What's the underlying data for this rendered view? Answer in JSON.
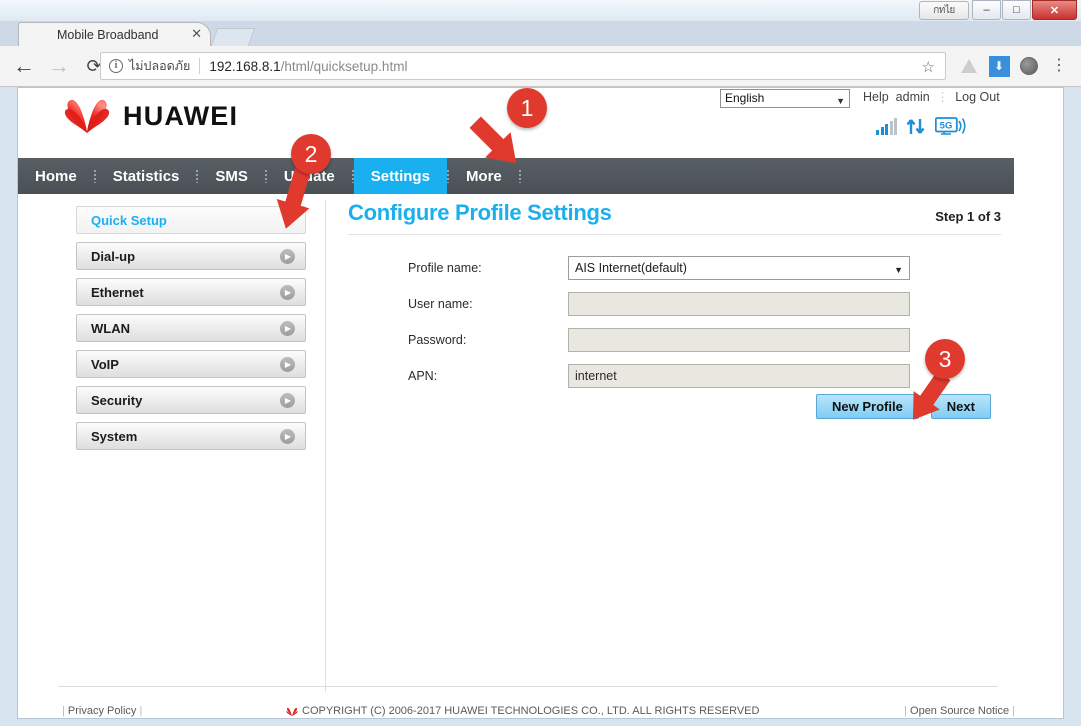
{
  "window": {
    "ime_label": "กทไย",
    "controls": [
      {
        "name": "minimize",
        "glyph": "–"
      },
      {
        "name": "maximize",
        "glyph": "□"
      },
      {
        "name": "close",
        "glyph": "✕"
      }
    ]
  },
  "browser": {
    "tab_title": "Mobile Broadband",
    "tab_close_glyph": "✕",
    "back_glyph": "←",
    "forward_glyph": "→",
    "reload_glyph": "⟳",
    "security_glyph": "i",
    "security_text": "ไม่ปลอดภัย",
    "url_host": "192.168.8.1",
    "url_path": "/html/quicksetup.html",
    "star_glyph": "☆",
    "menu_glyph": "⋮",
    "extensions": [
      "drive-icon",
      "download-icon",
      "film-icon"
    ]
  },
  "header": {
    "brand": "HUAWEI",
    "language": "English",
    "lang_arrow": "▼",
    "help_label": "Help",
    "user_label": "admin",
    "logout_label": "Log Out",
    "status_icons": [
      "signal-bars-icon",
      "data-transfer-icon",
      "5g-network-icon"
    ],
    "network_label": "5G"
  },
  "nav": {
    "items": [
      {
        "label": "Home",
        "active": false
      },
      {
        "label": "Statistics",
        "active": false
      },
      {
        "label": "SMS",
        "active": false
      },
      {
        "label": "Update",
        "active": false
      },
      {
        "label": "Settings",
        "active": true
      },
      {
        "label": "More",
        "active": false
      }
    ],
    "active_color": "#1ab0ef",
    "bar_color": "#4d5358"
  },
  "sidebar": {
    "items": [
      {
        "label": "Quick Setup",
        "selected": true,
        "chevron": false
      },
      {
        "label": "Dial-up",
        "selected": false,
        "chevron": true
      },
      {
        "label": "Ethernet",
        "selected": false,
        "chevron": true
      },
      {
        "label": "WLAN",
        "selected": false,
        "chevron": true
      },
      {
        "label": "VoIP",
        "selected": false,
        "chevron": true
      },
      {
        "label": "Security",
        "selected": false,
        "chevron": true
      },
      {
        "label": "System",
        "selected": false,
        "chevron": true
      }
    ],
    "chevron_glyph": "▶"
  },
  "content": {
    "title": "Configure Profile Settings",
    "step": "Step 1 of 3",
    "fields": [
      {
        "label": "Profile name:",
        "type": "select",
        "value": "AIS Internet(default)",
        "arrow": "▼"
      },
      {
        "label": "User name:",
        "type": "input",
        "value": ""
      },
      {
        "label": "Password:",
        "type": "input",
        "value": ""
      },
      {
        "label": "APN:",
        "type": "input",
        "value": "internet"
      }
    ],
    "buttons": [
      {
        "label": "New Profile",
        "name": "new-profile-button"
      },
      {
        "label": "Next",
        "name": "next-button"
      }
    ]
  },
  "footer": {
    "privacy": "Privacy Policy",
    "copyright": "COPYRIGHT (C) 2006-2017 HUAWEI TECHNOLOGIES CO., LTD. ALL RIGHTS RESERVED",
    "open_source": "Open Source Notice",
    "pipe": "|"
  },
  "annotations": {
    "color": "#e03a2f",
    "markers": [
      {
        "number": "1",
        "target": "settings-tab"
      },
      {
        "number": "2",
        "target": "quick-setup-sidebar-item"
      },
      {
        "number": "3",
        "target": "new-profile-button"
      }
    ]
  }
}
